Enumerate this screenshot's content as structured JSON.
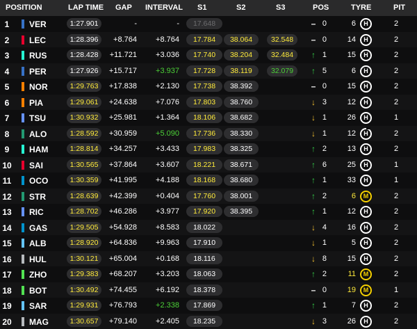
{
  "headers": {
    "position": "POSITION",
    "lap_time": "LAP TIME",
    "gap": "GAP",
    "interval": "INTERVAL",
    "s1": "S1",
    "s2": "S2",
    "s3": "S3",
    "pos": "POS",
    "tyre": "TYRE",
    "pit": "PIT"
  },
  "colors": {
    "personal_best_yellow": "#ffeb3b",
    "overall_best_green": "#4cd137",
    "gain_green": "#35d04a",
    "loss_yellow": "#f7c331",
    "medium_tyre": "#f5d000"
  },
  "rows": [
    {
      "pos": "1",
      "code": "VER",
      "team_color": "#3671c6",
      "lap": "1:27.901",
      "lap_style": "white",
      "gap": "-",
      "interval": "-",
      "interval_style": "white",
      "s1": "17.648",
      "s1_style": "grey",
      "s2": "",
      "s2_style": "",
      "s3": "",
      "s3_style": "",
      "arrow": "none",
      "pos_change": "0",
      "tyre_laps": "6",
      "tyre": "H",
      "tyre_used": false,
      "pit": "2"
    },
    {
      "pos": "2",
      "code": "LEC",
      "team_color": "#e8002d",
      "lap": "1:28.396",
      "lap_style": "white",
      "gap": "+8.764",
      "interval": "+8.764",
      "interval_style": "white",
      "s1": "17.784",
      "s1_style": "yellow",
      "s2": "38.064",
      "s2_style": "yellow",
      "s3": "32.548",
      "s3_style": "yellow",
      "arrow": "none",
      "pos_change": "0",
      "tyre_laps": "14",
      "tyre": "H",
      "tyre_used": false,
      "pit": "2"
    },
    {
      "pos": "3",
      "code": "RUS",
      "team_color": "#27f4d2",
      "lap": "1:28.428",
      "lap_style": "white",
      "gap": "+11.721",
      "interval": "+3.036",
      "interval_style": "white",
      "s1": "17.740",
      "s1_style": "yellow",
      "s2": "38.204",
      "s2_style": "yellow",
      "s3": "32.484",
      "s3_style": "yellow",
      "arrow": "up",
      "pos_change": "1",
      "tyre_laps": "15",
      "tyre": "H",
      "tyre_used": false,
      "pit": "2"
    },
    {
      "pos": "4",
      "code": "PER",
      "team_color": "#3671c6",
      "lap": "1:27.926",
      "lap_style": "white",
      "gap": "+15.717",
      "interval": "+3.937",
      "interval_style": "green",
      "s1": "17.728",
      "s1_style": "yellow",
      "s2": "38.119",
      "s2_style": "yellow",
      "s3": "32.079",
      "s3_style": "green",
      "arrow": "up",
      "pos_change": "5",
      "tyre_laps": "6",
      "tyre": "H",
      "tyre_used": false,
      "pit": "2"
    },
    {
      "pos": "5",
      "code": "NOR",
      "team_color": "#ff8000",
      "lap": "1:29.763",
      "lap_style": "yellow",
      "gap": "+17.838",
      "interval": "+2.130",
      "interval_style": "white",
      "s1": "17.738",
      "s1_style": "yellow",
      "s2": "38.392",
      "s2_style": "white",
      "s3": "",
      "s3_style": "",
      "arrow": "none",
      "pos_change": "0",
      "tyre_laps": "15",
      "tyre": "H",
      "tyre_used": false,
      "pit": "2"
    },
    {
      "pos": "6",
      "code": "PIA",
      "team_color": "#ff8000",
      "lap": "1:29.061",
      "lap_style": "yellow",
      "gap": "+24.638",
      "interval": "+7.076",
      "interval_style": "white",
      "s1": "17.803",
      "s1_style": "yellow",
      "s2": "38.760",
      "s2_style": "white",
      "s3": "",
      "s3_style": "",
      "arrow": "down",
      "pos_change": "3",
      "tyre_laps": "12",
      "tyre": "H",
      "tyre_used": false,
      "pit": "2"
    },
    {
      "pos": "7",
      "code": "TSU",
      "team_color": "#6692ff",
      "lap": "1:30.932",
      "lap_style": "yellow",
      "gap": "+25.981",
      "interval": "+1.364",
      "interval_style": "white",
      "s1": "18.106",
      "s1_style": "yellow",
      "s2": "38.682",
      "s2_style": "white",
      "s3": "",
      "s3_style": "",
      "arrow": "down",
      "pos_change": "1",
      "tyre_laps": "26",
      "tyre": "H",
      "tyre_used": false,
      "pit": "1"
    },
    {
      "pos": "8",
      "code": "ALO",
      "team_color": "#229971",
      "lap": "1:28.592",
      "lap_style": "yellow",
      "gap": "+30.959",
      "interval": "+5.090",
      "interval_style": "green",
      "s1": "17.736",
      "s1_style": "yellow",
      "s2": "38.330",
      "s2_style": "white",
      "s3": "",
      "s3_style": "",
      "arrow": "down",
      "pos_change": "1",
      "tyre_laps": "12",
      "tyre": "H",
      "tyre_used": true,
      "pit": "2"
    },
    {
      "pos": "9",
      "code": "HAM",
      "team_color": "#27f4d2",
      "lap": "1:28.814",
      "lap_style": "yellow",
      "gap": "+34.257",
      "interval": "+3.433",
      "interval_style": "white",
      "s1": "17.983",
      "s1_style": "yellow",
      "s2": "38.325",
      "s2_style": "white",
      "s3": "",
      "s3_style": "",
      "arrow": "up",
      "pos_change": "2",
      "tyre_laps": "13",
      "tyre": "H",
      "tyre_used": false,
      "pit": "2"
    },
    {
      "pos": "10",
      "code": "SAI",
      "team_color": "#e8002d",
      "lap": "1:30.565",
      "lap_style": "yellow",
      "gap": "+37.864",
      "interval": "+3.607",
      "interval_style": "white",
      "s1": "18.221",
      "s1_style": "yellow",
      "s2": "38.671",
      "s2_style": "white",
      "s3": "",
      "s3_style": "",
      "arrow": "up",
      "pos_change": "6",
      "tyre_laps": "25",
      "tyre": "H",
      "tyre_used": false,
      "pit": "1"
    },
    {
      "pos": "11",
      "code": "OCO",
      "team_color": "#0093cc",
      "lap": "1:30.359",
      "lap_style": "yellow",
      "gap": "+41.995",
      "interval": "+4.188",
      "interval_style": "white",
      "s1": "18.168",
      "s1_style": "yellow",
      "s2": "38.680",
      "s2_style": "white",
      "s3": "",
      "s3_style": "",
      "arrow": "up",
      "pos_change": "1",
      "tyre_laps": "33",
      "tyre": "H",
      "tyre_used": false,
      "pit": "1"
    },
    {
      "pos": "12",
      "code": "STR",
      "team_color": "#229971",
      "lap": "1:28.639",
      "lap_style": "yellow",
      "gap": "+42.399",
      "interval": "+0.404",
      "interval_style": "white",
      "s1": "17.760",
      "s1_style": "yellow",
      "s2": "38.001",
      "s2_style": "white",
      "s3": "",
      "s3_style": "",
      "arrow": "up",
      "pos_change": "2",
      "tyre_laps": "6",
      "tyre": "M",
      "tyre_used": false,
      "pit": "2"
    },
    {
      "pos": "13",
      "code": "RIC",
      "team_color": "#6692ff",
      "lap": "1:28.702",
      "lap_style": "yellow",
      "gap": "+46.286",
      "interval": "+3.977",
      "interval_style": "white",
      "s1": "17.920",
      "s1_style": "yellow",
      "s2": "38.395",
      "s2_style": "white",
      "s3": "",
      "s3_style": "",
      "arrow": "up",
      "pos_change": "1",
      "tyre_laps": "12",
      "tyre": "H",
      "tyre_used": false,
      "pit": "2"
    },
    {
      "pos": "14",
      "code": "GAS",
      "team_color": "#0093cc",
      "lap": "1:29.505",
      "lap_style": "yellow",
      "gap": "+54.928",
      "interval": "+8.583",
      "interval_style": "white",
      "s1": "18.022",
      "s1_style": "white",
      "s2": "",
      "s2_style": "",
      "s3": "",
      "s3_style": "",
      "arrow": "down",
      "pos_change": "4",
      "tyre_laps": "16",
      "tyre": "H",
      "tyre_used": false,
      "pit": "2"
    },
    {
      "pos": "15",
      "code": "ALB",
      "team_color": "#64c4ff",
      "lap": "1:28.920",
      "lap_style": "yellow",
      "gap": "+64.836",
      "interval": "+9.963",
      "interval_style": "white",
      "s1": "17.910",
      "s1_style": "white",
      "s2": "",
      "s2_style": "",
      "s3": "",
      "s3_style": "",
      "arrow": "down",
      "pos_change": "1",
      "tyre_laps": "5",
      "tyre": "H",
      "tyre_used": false,
      "pit": "2"
    },
    {
      "pos": "16",
      "code": "HUL",
      "team_color": "#b6babd",
      "lap": "1:30.121",
      "lap_style": "yellow",
      "gap": "+65.004",
      "interval": "+0.168",
      "interval_style": "white",
      "s1": "18.116",
      "s1_style": "white",
      "s2": "",
      "s2_style": "",
      "s3": "",
      "s3_style": "",
      "arrow": "down",
      "pos_change": "8",
      "tyre_laps": "15",
      "tyre": "H",
      "tyre_used": false,
      "pit": "2"
    },
    {
      "pos": "17",
      "code": "ZHO",
      "team_color": "#52e252",
      "lap": "1:29.383",
      "lap_style": "yellow",
      "gap": "+68.207",
      "interval": "+3.203",
      "interval_style": "white",
      "s1": "18.063",
      "s1_style": "white",
      "s2": "",
      "s2_style": "",
      "s3": "",
      "s3_style": "",
      "arrow": "up",
      "pos_change": "2",
      "tyre_laps": "11",
      "tyre": "M",
      "tyre_used": false,
      "pit": "2"
    },
    {
      "pos": "18",
      "code": "BOT",
      "team_color": "#52e252",
      "lap": "1:30.492",
      "lap_style": "yellow",
      "gap": "+74.455",
      "interval": "+6.192",
      "interval_style": "white",
      "s1": "18.378",
      "s1_style": "white",
      "s2": "",
      "s2_style": "",
      "s3": "",
      "s3_style": "",
      "arrow": "none",
      "pos_change": "0",
      "tyre_laps": "19",
      "tyre": "M",
      "tyre_used": false,
      "pit": "1"
    },
    {
      "pos": "19",
      "code": "SAR",
      "team_color": "#64c4ff",
      "lap": "1:29.931",
      "lap_style": "yellow",
      "gap": "+76.793",
      "interval": "+2.338",
      "interval_style": "green",
      "s1": "17.869",
      "s1_style": "white",
      "s2": "",
      "s2_style": "",
      "s3": "",
      "s3_style": "",
      "arrow": "up",
      "pos_change": "1",
      "tyre_laps": "7",
      "tyre": "H",
      "tyre_used": false,
      "pit": "2"
    },
    {
      "pos": "20",
      "code": "MAG",
      "team_color": "#b6babd",
      "lap": "1:30.657",
      "lap_style": "yellow",
      "gap": "+79.140",
      "interval": "+2.405",
      "interval_style": "white",
      "s1": "18.235",
      "s1_style": "white",
      "s2": "",
      "s2_style": "",
      "s3": "",
      "s3_style": "",
      "arrow": "down",
      "pos_change": "3",
      "tyre_laps": "26",
      "tyre": "H",
      "tyre_used": false,
      "pit": "2"
    }
  ]
}
